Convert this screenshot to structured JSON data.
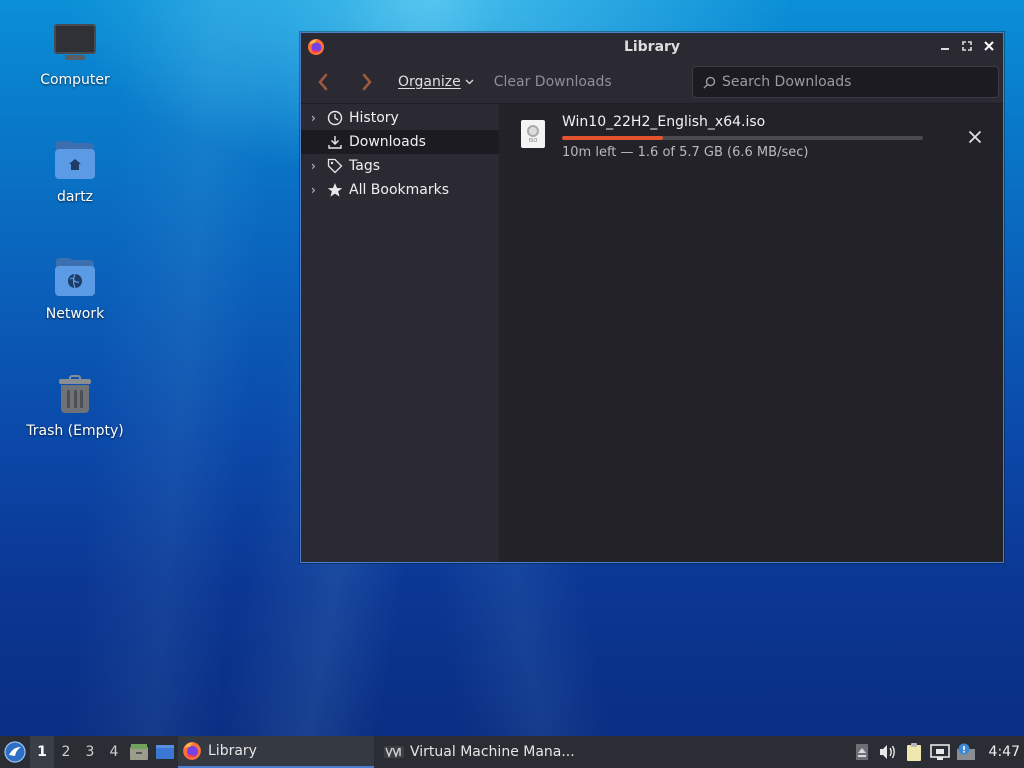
{
  "desktop": {
    "icons": [
      {
        "label": "Computer",
        "icon": "computer-icon"
      },
      {
        "label": "dartz",
        "icon": "home-folder-icon"
      },
      {
        "label": "Network",
        "icon": "network-folder-icon"
      },
      {
        "label": "Trash (Empty)",
        "icon": "trash-icon"
      }
    ]
  },
  "window": {
    "title": "Library",
    "controls": {
      "minimize": "minimize-icon",
      "maximize": "maximize-icon",
      "close": "close-icon"
    },
    "toolbar": {
      "organize_label": "Organize",
      "clear_downloads_label": "Clear Downloads",
      "search_placeholder": "Search Downloads"
    },
    "sidebar": {
      "items": [
        {
          "label": "History",
          "icon": "history-icon",
          "expandable": true
        },
        {
          "label": "Downloads",
          "icon": "download-icon",
          "expandable": false,
          "selected": true
        },
        {
          "label": "Tags",
          "icon": "tag-icon",
          "expandable": true
        },
        {
          "label": "All Bookmarks",
          "icon": "star-icon",
          "expandable": true
        }
      ]
    },
    "downloads": [
      {
        "filename": "Win10_22H2_English_x64.iso",
        "file_icon_text": "ISO",
        "progress_fraction": 0.28,
        "status": "10m left — 1.6 of 5.7 GB (6.6 MB/sec)"
      }
    ]
  },
  "taskbar": {
    "workspaces": [
      "1",
      "2",
      "3",
      "4"
    ],
    "active_workspace": "1",
    "tasks": [
      {
        "label": "Library",
        "icon": "firefox-icon",
        "active": true
      },
      {
        "label": "Virtual Machine Mana...",
        "icon": "virt-manager-icon",
        "active": false
      }
    ],
    "clock": "4:47",
    "colors": {
      "accent": "#4a7fd0",
      "progress": "#e4532f"
    }
  }
}
